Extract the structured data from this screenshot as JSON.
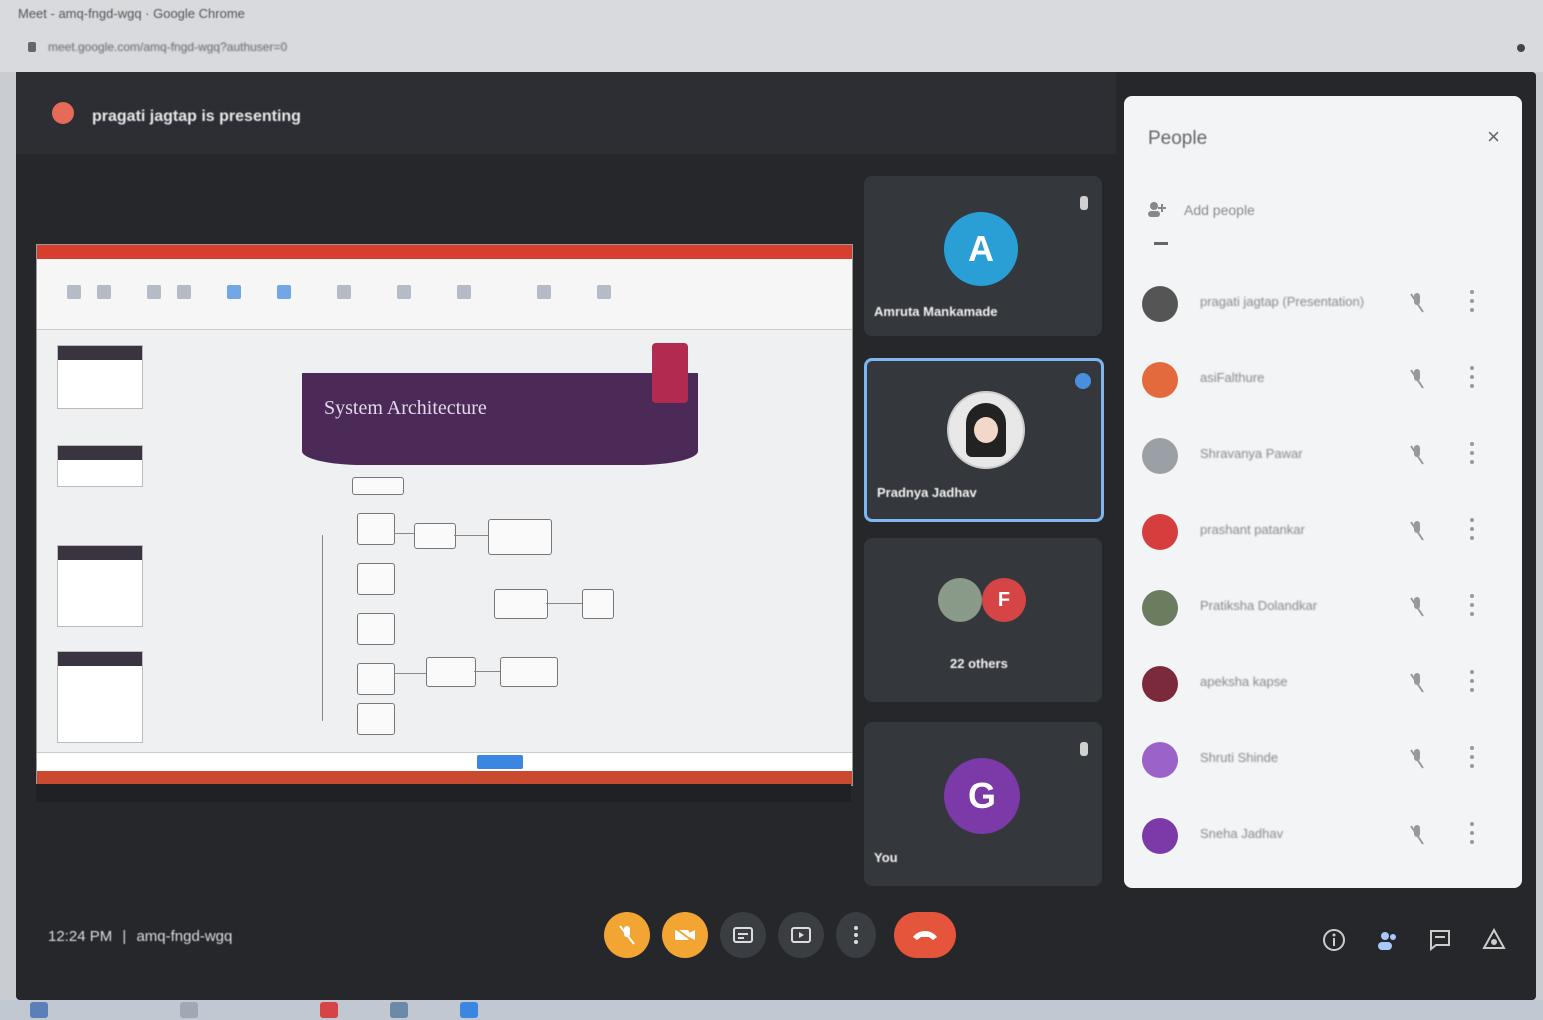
{
  "browser": {
    "tab_title": "Meet - amq-fngd-wgq · Google Chrome",
    "url": "meet.google.com/amq-fngd-wgq?authuser=0"
  },
  "presentation": {
    "presenter_text": "pragati jagtap is presenting",
    "slide_title": "System Architecture"
  },
  "tiles": [
    {
      "name": "Amruta Mankamade",
      "initial": "A",
      "color": "#2a9fd6"
    },
    {
      "name": "Pradnya Jadhav",
      "initial": "",
      "color": "#e8e8e8"
    },
    {
      "name": "22 others",
      "initial": "F",
      "color": "#d64545"
    },
    {
      "name": "You",
      "initial": "G",
      "color": "#7b3aa8"
    }
  ],
  "people_panel": {
    "title": "People",
    "close_label": "×",
    "add_label": "Add people",
    "participants": [
      {
        "name": "pragati jagtap (Presentation)",
        "color": "#555555"
      },
      {
        "name": "asiFalthure",
        "color": "#e26a3c"
      },
      {
        "name": "Shravanya Pawar",
        "color": "#9aa0a6"
      },
      {
        "name": "prashant patankar",
        "color": "#d63d3d"
      },
      {
        "name": "Pratiksha Dolandkar",
        "color": "#6b7d5e"
      },
      {
        "name": "apeksha kapse",
        "color": "#7a2a3a"
      },
      {
        "name": "Shruti Shinde",
        "color": "#9b62c9"
      },
      {
        "name": "Sneha Jadhav",
        "color": "#7b3aa8"
      }
    ]
  },
  "bottom_bar": {
    "time": "12:24 PM",
    "separator": "|",
    "meeting_code": "amq-fngd-wgq"
  },
  "colors": {
    "meet_bg": "#25272b",
    "end_call": "#e4553b",
    "active_border": "#7fb5f0"
  }
}
